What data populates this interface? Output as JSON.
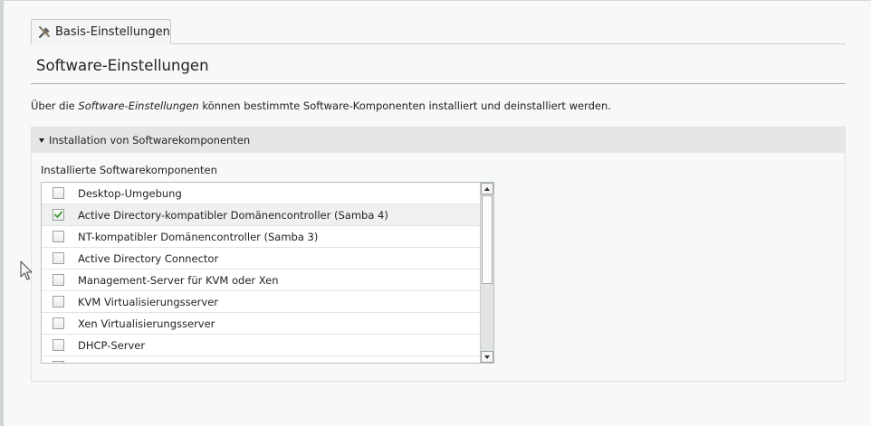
{
  "tabs": [
    {
      "label": "Basis-Einstellungen",
      "icon": "tools-icon"
    }
  ],
  "page": {
    "title": "Software-Einstellungen",
    "description_prefix": "Über die ",
    "description_emphasis": "Software-Einstellungen",
    "description_suffix": " können bestimmte Software-Komponenten installiert und deinstalliert werden."
  },
  "section": {
    "title": "Installation von Softwarekomponenten",
    "expanded": true,
    "field_label": "Installierte Softwarekomponenten",
    "items": [
      {
        "label": "Desktop-Umgebung",
        "checked": false
      },
      {
        "label": "Active Directory-kompatibler Domänencontroller (Samba 4)",
        "checked": true
      },
      {
        "label": "NT-kompatibler Domänencontroller (Samba 3)",
        "checked": false
      },
      {
        "label": "Active Directory Connector",
        "checked": false
      },
      {
        "label": "Management-Server für KVM oder Xen",
        "checked": false
      },
      {
        "label": "KVM Virtualisierungsserver",
        "checked": false
      },
      {
        "label": "Xen Virtualisierungsserver",
        "checked": false
      },
      {
        "label": "DHCP-Server",
        "checked": false
      },
      {
        "label": "",
        "checked": false
      }
    ]
  },
  "colors": {
    "background": "#f6f9f7",
    "section_header": "#e5e7e6",
    "check_green": "#3c9a2e"
  }
}
